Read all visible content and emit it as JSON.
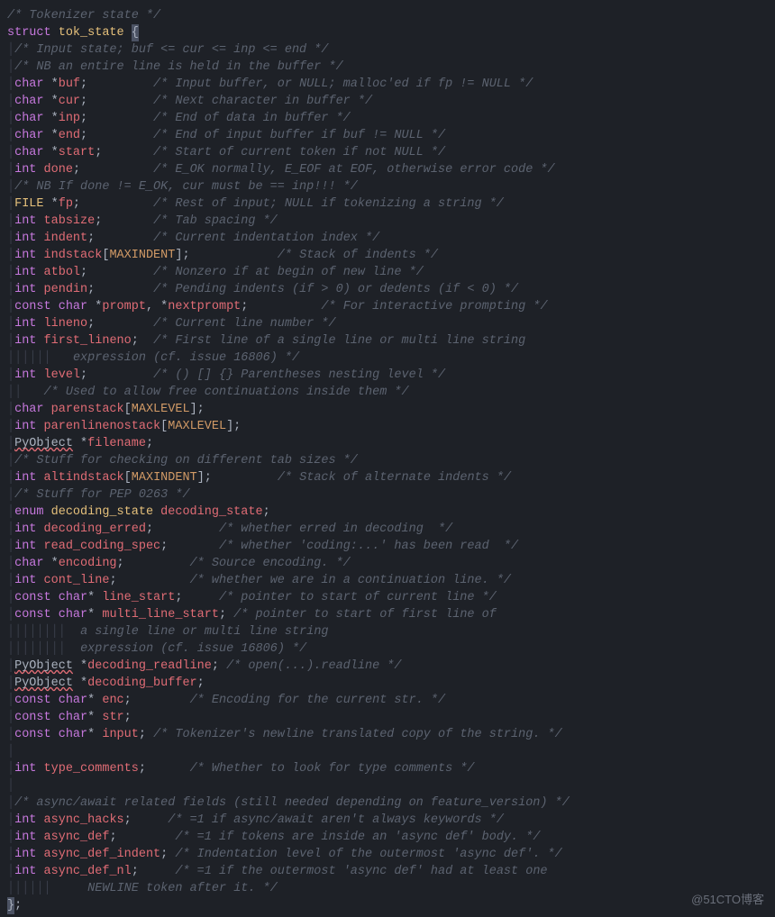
{
  "watermark": "@51CTO博客",
  "lines": [
    {
      "i": 0,
      "segs": [
        {
          "c": "tok-comment",
          "t": "/* Tokenizer state */"
        }
      ]
    },
    {
      "i": 0,
      "segs": [
        {
          "c": "tok-struct",
          "t": "struct"
        },
        {
          "c": "",
          "t": " "
        },
        {
          "c": "tok-name",
          "t": "tok_state"
        },
        {
          "c": "",
          "t": " "
        },
        {
          "c": "brace-hl",
          "t": "{"
        }
      ]
    },
    {
      "i": 1,
      "segs": [
        {
          "c": "tok-comment",
          "t": "/* Input state; buf <= cur <= inp <= end */"
        }
      ]
    },
    {
      "i": 1,
      "segs": [
        {
          "c": "tok-comment",
          "t": "/* NB an entire line is held in the buffer */"
        }
      ]
    },
    {
      "i": 1,
      "segs": [
        {
          "c": "tok-type",
          "t": "char"
        },
        {
          "c": "",
          "t": " *"
        },
        {
          "c": "tok-ident",
          "t": "buf"
        },
        {
          "c": "",
          "t": ";         "
        },
        {
          "c": "tok-comment",
          "t": "/* Input buffer, or NULL; malloc'ed if fp != NULL */"
        }
      ]
    },
    {
      "i": 1,
      "segs": [
        {
          "c": "tok-type",
          "t": "char"
        },
        {
          "c": "",
          "t": " *"
        },
        {
          "c": "tok-ident",
          "t": "cur"
        },
        {
          "c": "",
          "t": ";         "
        },
        {
          "c": "tok-comment",
          "t": "/* Next character in buffer */"
        }
      ]
    },
    {
      "i": 1,
      "segs": [
        {
          "c": "tok-type",
          "t": "char"
        },
        {
          "c": "",
          "t": " *"
        },
        {
          "c": "tok-ident",
          "t": "inp"
        },
        {
          "c": "",
          "t": ";         "
        },
        {
          "c": "tok-comment",
          "t": "/* End of data in buffer */"
        }
      ]
    },
    {
      "i": 1,
      "segs": [
        {
          "c": "tok-type",
          "t": "char"
        },
        {
          "c": "",
          "t": " *"
        },
        {
          "c": "tok-ident",
          "t": "end"
        },
        {
          "c": "",
          "t": ";         "
        },
        {
          "c": "tok-comment",
          "t": "/* End of input buffer if buf != NULL */"
        }
      ]
    },
    {
      "i": 1,
      "segs": [
        {
          "c": "tok-type",
          "t": "char"
        },
        {
          "c": "",
          "t": " *"
        },
        {
          "c": "tok-ident",
          "t": "start"
        },
        {
          "c": "",
          "t": ";       "
        },
        {
          "c": "tok-comment",
          "t": "/* Start of current token if not NULL */"
        }
      ]
    },
    {
      "i": 1,
      "segs": [
        {
          "c": "tok-type",
          "t": "int"
        },
        {
          "c": "",
          "t": " "
        },
        {
          "c": "tok-ident",
          "t": "done"
        },
        {
          "c": "",
          "t": ";          "
        },
        {
          "c": "tok-comment",
          "t": "/* E_OK normally, E_EOF at EOF, otherwise error code */"
        }
      ]
    },
    {
      "i": 1,
      "segs": [
        {
          "c": "tok-comment",
          "t": "/* NB If done != E_OK, cur must be == inp!!! */"
        }
      ]
    },
    {
      "i": 1,
      "segs": [
        {
          "c": "tok-name",
          "t": "FILE"
        },
        {
          "c": "",
          "t": " *"
        },
        {
          "c": "tok-ident",
          "t": "fp"
        },
        {
          "c": "",
          "t": ";          "
        },
        {
          "c": "tok-comment",
          "t": "/* Rest of input; NULL if tokenizing a string */"
        }
      ]
    },
    {
      "i": 1,
      "segs": [
        {
          "c": "tok-type",
          "t": "int"
        },
        {
          "c": "",
          "t": " "
        },
        {
          "c": "tok-ident",
          "t": "tabsize"
        },
        {
          "c": "",
          "t": ";       "
        },
        {
          "c": "tok-comment",
          "t": "/* Tab spacing */"
        }
      ]
    },
    {
      "i": 1,
      "segs": [
        {
          "c": "tok-type",
          "t": "int"
        },
        {
          "c": "",
          "t": " "
        },
        {
          "c": "tok-ident",
          "t": "indent"
        },
        {
          "c": "",
          "t": ";        "
        },
        {
          "c": "tok-comment",
          "t": "/* Current indentation index */"
        }
      ]
    },
    {
      "i": 1,
      "segs": [
        {
          "c": "tok-type",
          "t": "int"
        },
        {
          "c": "",
          "t": " "
        },
        {
          "c": "tok-ident",
          "t": "indstack"
        },
        {
          "c": "",
          "t": "["
        },
        {
          "c": "tok-const",
          "t": "MAXINDENT"
        },
        {
          "c": "",
          "t": "];            "
        },
        {
          "c": "tok-comment",
          "t": "/* Stack of indents */"
        }
      ]
    },
    {
      "i": 1,
      "segs": [
        {
          "c": "tok-type",
          "t": "int"
        },
        {
          "c": "",
          "t": " "
        },
        {
          "c": "tok-ident",
          "t": "atbol"
        },
        {
          "c": "",
          "t": ";         "
        },
        {
          "c": "tok-comment",
          "t": "/* Nonzero if at begin of new line */"
        }
      ]
    },
    {
      "i": 1,
      "segs": [
        {
          "c": "tok-type",
          "t": "int"
        },
        {
          "c": "",
          "t": " "
        },
        {
          "c": "tok-ident",
          "t": "pendin"
        },
        {
          "c": "",
          "t": ";        "
        },
        {
          "c": "tok-comment",
          "t": "/* Pending indents (if > 0) or dedents (if < 0) */"
        }
      ]
    },
    {
      "i": 1,
      "segs": [
        {
          "c": "tok-type",
          "t": "const"
        },
        {
          "c": "",
          "t": " "
        },
        {
          "c": "tok-type",
          "t": "char"
        },
        {
          "c": "",
          "t": " *"
        },
        {
          "c": "tok-ident",
          "t": "prompt"
        },
        {
          "c": "",
          "t": ", *"
        },
        {
          "c": "tok-ident",
          "t": "nextprompt"
        },
        {
          "c": "",
          "t": ";          "
        },
        {
          "c": "tok-comment",
          "t": "/* For interactive prompting */"
        }
      ]
    },
    {
      "i": 1,
      "segs": [
        {
          "c": "tok-type",
          "t": "int"
        },
        {
          "c": "",
          "t": " "
        },
        {
          "c": "tok-ident",
          "t": "lineno"
        },
        {
          "c": "",
          "t": ";        "
        },
        {
          "c": "tok-comment",
          "t": "/* Current line number */"
        }
      ]
    },
    {
      "i": 1,
      "segs": [
        {
          "c": "tok-type",
          "t": "int"
        },
        {
          "c": "",
          "t": " "
        },
        {
          "c": "tok-ident",
          "t": "first_lineno"
        },
        {
          "c": "",
          "t": ";  "
        },
        {
          "c": "tok-comment",
          "t": "/* First line of a single line or multi line string"
        }
      ]
    },
    {
      "i": 1,
      "guides": 5,
      "segs": [
        {
          "c": "tok-comment",
          "t": "   expression (cf. issue 16806) */"
        }
      ]
    },
    {
      "i": 1,
      "segs": [
        {
          "c": "tok-type",
          "t": "int"
        },
        {
          "c": "",
          "t": " "
        },
        {
          "c": "tok-ident",
          "t": "level"
        },
        {
          "c": "",
          "t": ";         "
        },
        {
          "c": "tok-comment",
          "t": "/* () [] {} Parentheses nesting level */"
        }
      ]
    },
    {
      "i": 1,
      "guides": 1,
      "segs": [
        {
          "c": "",
          "t": "   "
        },
        {
          "c": "tok-comment",
          "t": "/* Used to allow free continuations inside them */"
        }
      ]
    },
    {
      "i": 1,
      "segs": [
        {
          "c": "tok-type",
          "t": "char"
        },
        {
          "c": "",
          "t": " "
        },
        {
          "c": "tok-ident",
          "t": "parenstack"
        },
        {
          "c": "",
          "t": "["
        },
        {
          "c": "tok-const",
          "t": "MAXLEVEL"
        },
        {
          "c": "",
          "t": "];"
        }
      ]
    },
    {
      "i": 1,
      "segs": [
        {
          "c": "tok-type",
          "t": "int"
        },
        {
          "c": "",
          "t": " "
        },
        {
          "c": "tok-ident",
          "t": "parenlinenostack"
        },
        {
          "c": "",
          "t": "["
        },
        {
          "c": "tok-const",
          "t": "MAXLEVEL"
        },
        {
          "c": "",
          "t": "];"
        }
      ]
    },
    {
      "i": 1,
      "segs": [
        {
          "c": "err",
          "t": "PyObject"
        },
        {
          "c": "",
          "t": " *"
        },
        {
          "c": "tok-ident",
          "t": "filename"
        },
        {
          "c": "",
          "t": ";"
        }
      ]
    },
    {
      "i": 1,
      "segs": [
        {
          "c": "tok-comment",
          "t": "/* Stuff for checking on different tab sizes */"
        }
      ]
    },
    {
      "i": 1,
      "segs": [
        {
          "c": "tok-type",
          "t": "int"
        },
        {
          "c": "",
          "t": " "
        },
        {
          "c": "tok-ident",
          "t": "altindstack"
        },
        {
          "c": "",
          "t": "["
        },
        {
          "c": "tok-const",
          "t": "MAXINDENT"
        },
        {
          "c": "",
          "t": "];         "
        },
        {
          "c": "tok-comment",
          "t": "/* Stack of alternate indents */"
        }
      ]
    },
    {
      "i": 1,
      "segs": [
        {
          "c": "tok-comment",
          "t": "/* Stuff for PEP 0263 */"
        }
      ]
    },
    {
      "i": 1,
      "segs": [
        {
          "c": "tok-type",
          "t": "enum"
        },
        {
          "c": "",
          "t": " "
        },
        {
          "c": "tok-name",
          "t": "decoding_state"
        },
        {
          "c": "",
          "t": " "
        },
        {
          "c": "tok-ident",
          "t": "decoding_state"
        },
        {
          "c": "",
          "t": ";"
        }
      ]
    },
    {
      "i": 1,
      "segs": [
        {
          "c": "tok-type",
          "t": "int"
        },
        {
          "c": "",
          "t": " "
        },
        {
          "c": "tok-ident",
          "t": "decoding_erred"
        },
        {
          "c": "",
          "t": ";         "
        },
        {
          "c": "tok-comment",
          "t": "/* whether erred in decoding  */"
        }
      ]
    },
    {
      "i": 1,
      "segs": [
        {
          "c": "tok-type",
          "t": "int"
        },
        {
          "c": "",
          "t": " "
        },
        {
          "c": "tok-ident",
          "t": "read_coding_spec"
        },
        {
          "c": "",
          "t": ";       "
        },
        {
          "c": "tok-comment",
          "t": "/* whether 'coding:...' has been read  */"
        }
      ]
    },
    {
      "i": 1,
      "segs": [
        {
          "c": "tok-type",
          "t": "char"
        },
        {
          "c": "",
          "t": " *"
        },
        {
          "c": "tok-ident",
          "t": "encoding"
        },
        {
          "c": "",
          "t": ";         "
        },
        {
          "c": "tok-comment",
          "t": "/* Source encoding. */"
        }
      ]
    },
    {
      "i": 1,
      "segs": [
        {
          "c": "tok-type",
          "t": "int"
        },
        {
          "c": "",
          "t": " "
        },
        {
          "c": "tok-ident",
          "t": "cont_line"
        },
        {
          "c": "",
          "t": ";          "
        },
        {
          "c": "tok-comment",
          "t": "/* whether we are in a continuation line. */"
        }
      ]
    },
    {
      "i": 1,
      "segs": [
        {
          "c": "tok-type",
          "t": "const"
        },
        {
          "c": "",
          "t": " "
        },
        {
          "c": "tok-type",
          "t": "char"
        },
        {
          "c": "",
          "t": "* "
        },
        {
          "c": "tok-ident",
          "t": "line_start"
        },
        {
          "c": "",
          "t": ";     "
        },
        {
          "c": "tok-comment",
          "t": "/* pointer to start of current line */"
        }
      ]
    },
    {
      "i": 1,
      "segs": [
        {
          "c": "tok-type",
          "t": "const"
        },
        {
          "c": "",
          "t": " "
        },
        {
          "c": "tok-type",
          "t": "char"
        },
        {
          "c": "",
          "t": "* "
        },
        {
          "c": "tok-ident",
          "t": "multi_line_start"
        },
        {
          "c": "",
          "t": "; "
        },
        {
          "c": "tok-comment",
          "t": "/* pointer to start of first line of"
        }
      ]
    },
    {
      "i": 1,
      "guides": 7,
      "segs": [
        {
          "c": "tok-comment",
          "t": "  a single line or multi line string"
        }
      ]
    },
    {
      "i": 1,
      "guides": 7,
      "segs": [
        {
          "c": "tok-comment",
          "t": "  expression (cf. issue 16806) */"
        }
      ]
    },
    {
      "i": 1,
      "segs": [
        {
          "c": "err",
          "t": "PyObject"
        },
        {
          "c": "",
          "t": " *"
        },
        {
          "c": "tok-ident",
          "t": "decoding_readline"
        },
        {
          "c": "",
          "t": "; "
        },
        {
          "c": "tok-comment",
          "t": "/* open(...).readline */"
        }
      ]
    },
    {
      "i": 1,
      "segs": [
        {
          "c": "err",
          "t": "PyObject"
        },
        {
          "c": "",
          "t": " *"
        },
        {
          "c": "tok-ident",
          "t": "decoding_buffer"
        },
        {
          "c": "",
          "t": ";"
        }
      ]
    },
    {
      "i": 1,
      "segs": [
        {
          "c": "tok-type",
          "t": "const"
        },
        {
          "c": "",
          "t": " "
        },
        {
          "c": "tok-type",
          "t": "char"
        },
        {
          "c": "",
          "t": "* "
        },
        {
          "c": "tok-ident",
          "t": "enc"
        },
        {
          "c": "",
          "t": ";        "
        },
        {
          "c": "tok-comment",
          "t": "/* Encoding for the current str. */"
        }
      ]
    },
    {
      "i": 1,
      "segs": [
        {
          "c": "tok-type",
          "t": "const"
        },
        {
          "c": "",
          "t": " "
        },
        {
          "c": "tok-type",
          "t": "char"
        },
        {
          "c": "",
          "t": "* "
        },
        {
          "c": "tok-ident",
          "t": "str"
        },
        {
          "c": "",
          "t": ";"
        }
      ]
    },
    {
      "i": 1,
      "segs": [
        {
          "c": "tok-type",
          "t": "const"
        },
        {
          "c": "",
          "t": " "
        },
        {
          "c": "tok-type",
          "t": "char"
        },
        {
          "c": "",
          "t": "* "
        },
        {
          "c": "tok-ident",
          "t": "input"
        },
        {
          "c": "",
          "t": "; "
        },
        {
          "c": "tok-comment",
          "t": "/* Tokenizer's newline translated copy of the string. */"
        }
      ]
    },
    {
      "i": 1,
      "segs": [
        {
          "c": "",
          "t": ""
        }
      ]
    },
    {
      "i": 1,
      "segs": [
        {
          "c": "tok-type",
          "t": "int"
        },
        {
          "c": "",
          "t": " "
        },
        {
          "c": "tok-ident",
          "t": "type_comments"
        },
        {
          "c": "",
          "t": ";      "
        },
        {
          "c": "tok-comment",
          "t": "/* Whether to look for type comments */"
        }
      ]
    },
    {
      "i": 1,
      "segs": [
        {
          "c": "",
          "t": ""
        }
      ]
    },
    {
      "i": 1,
      "segs": [
        {
          "c": "tok-comment",
          "t": "/* async/await related fields (still needed depending on feature_version) */"
        }
      ]
    },
    {
      "i": 1,
      "segs": [
        {
          "c": "tok-type",
          "t": "int"
        },
        {
          "c": "",
          "t": " "
        },
        {
          "c": "tok-ident",
          "t": "async_hacks"
        },
        {
          "c": "",
          "t": ";     "
        },
        {
          "c": "tok-comment",
          "t": "/* =1 if async/await aren't always keywords */"
        }
      ]
    },
    {
      "i": 1,
      "segs": [
        {
          "c": "tok-type",
          "t": "int"
        },
        {
          "c": "",
          "t": " "
        },
        {
          "c": "tok-ident",
          "t": "async_def"
        },
        {
          "c": "",
          "t": ";        "
        },
        {
          "c": "tok-comment",
          "t": "/* =1 if tokens are inside an 'async def' body. */"
        }
      ]
    },
    {
      "i": 1,
      "segs": [
        {
          "c": "tok-type",
          "t": "int"
        },
        {
          "c": "",
          "t": " "
        },
        {
          "c": "tok-ident",
          "t": "async_def_indent"
        },
        {
          "c": "",
          "t": "; "
        },
        {
          "c": "tok-comment",
          "t": "/* Indentation level of the outermost 'async def'. */"
        }
      ]
    },
    {
      "i": 1,
      "segs": [
        {
          "c": "tok-type",
          "t": "int"
        },
        {
          "c": "",
          "t": " "
        },
        {
          "c": "tok-ident",
          "t": "async_def_nl"
        },
        {
          "c": "",
          "t": ";     "
        },
        {
          "c": "tok-comment",
          "t": "/* =1 if the outermost 'async def' had at least one"
        }
      ]
    },
    {
      "i": 1,
      "guides": 5,
      "segs": [
        {
          "c": "tok-comment",
          "t": "     NEWLINE token after it. */"
        }
      ]
    },
    {
      "i": 0,
      "segs": [
        {
          "c": "brace-hl",
          "t": "}"
        },
        {
          "c": "",
          "t": ";"
        }
      ]
    }
  ]
}
